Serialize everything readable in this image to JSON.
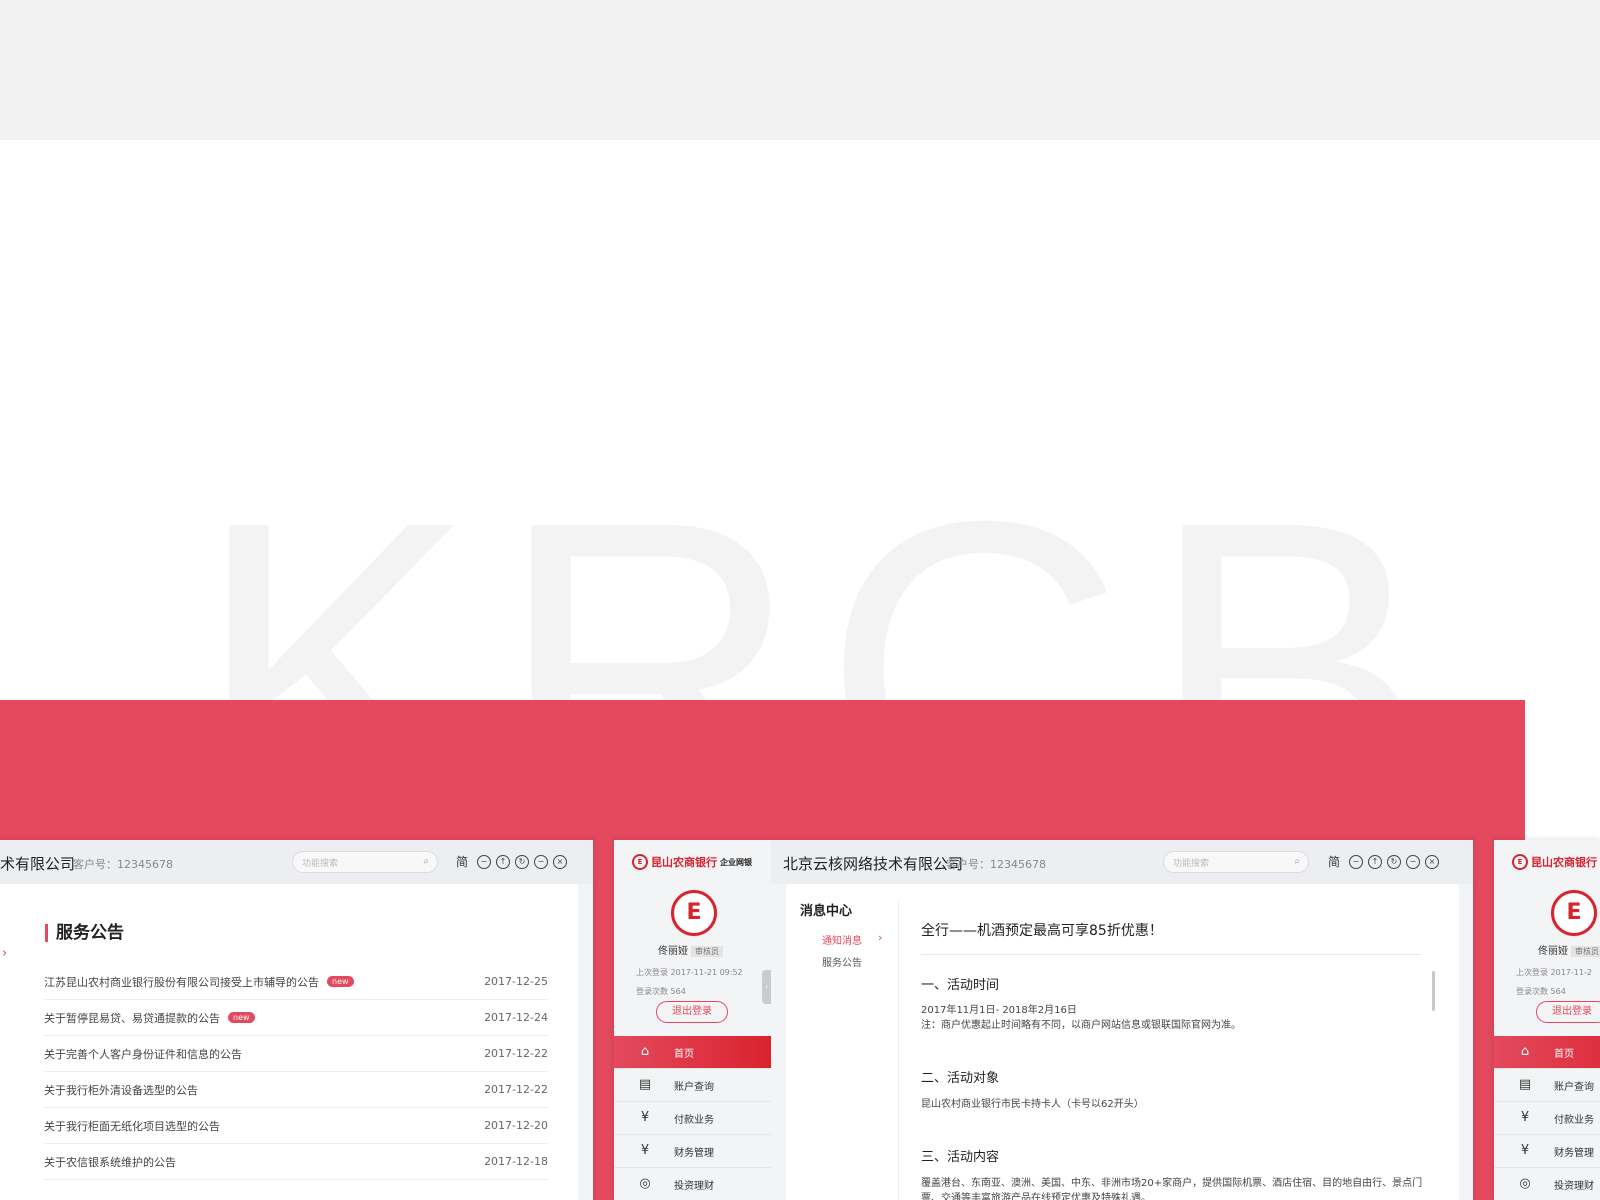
{
  "backdrop": {
    "letters": "KRCB"
  },
  "accent": "#e4495e",
  "company": "北京云核网络技术有限公司",
  "customer_no": "客户号：12345678",
  "search_placeholder": "功能搜索",
  "lang_toggle": "简",
  "window_controls": [
    "minus-circle-icon",
    "upload-circle-icon",
    "refresh-circle-icon",
    "minimize-circle-icon",
    "close-circle-icon"
  ],
  "left_window": {
    "company_visible": "术有限公司",
    "announcements_title": "服务公告",
    "rows": [
      {
        "title": "江苏昆山农村商业银行股份有限公司接受上市辅导的公告",
        "badge": "new",
        "date": "2017-12-25"
      },
      {
        "title": "关于暂停昆易贷、易贷通提款的公告",
        "badge": "new",
        "date": "2017-12-24"
      },
      {
        "title": "关于完善个人客户身份证件和信息的公告",
        "badge": "",
        "date": "2017-12-22"
      },
      {
        "title": "关于我行柜外清设备选型的公告",
        "badge": "",
        "date": "2017-12-22"
      },
      {
        "title": "关于我行柜面无纸化项目选型的公告",
        "badge": "",
        "date": "2017-12-20"
      },
      {
        "title": "关于农信银系统维护的公告",
        "badge": "",
        "date": "2017-12-18"
      }
    ]
  },
  "sidebar": {
    "bank_name": "昆山农商银行",
    "bank_suffix": "企业网银",
    "user_name": "佟丽娅",
    "role": "审核员",
    "last_login": "上次登录  2017-11-21 09:52",
    "login_count": "登录次数  564",
    "logout_label": "退出登录",
    "nav": [
      {
        "icon": "home-icon",
        "label": "首页",
        "active": true
      },
      {
        "icon": "account-query-icon",
        "label": "账户查询",
        "active": false
      },
      {
        "icon": "payment-icon",
        "label": "付款业务",
        "active": false
      },
      {
        "icon": "finance-icon",
        "label": "财务管理",
        "active": false
      },
      {
        "icon": "investment-icon",
        "label": "投资理财",
        "active": false
      }
    ]
  },
  "right_sidebar": {
    "user_name": "佟丽娅",
    "role_visible": "审核员",
    "last_login_visible": "上次登录  2017-11-2",
    "login_count": "登录次数  564",
    "logout_label": "退出登录",
    "nav": [
      "首页",
      "账户查询",
      "付款业务",
      "财务管理",
      "投资理财"
    ]
  },
  "message_center": {
    "title": "消息中心",
    "sub_active": "通知消息",
    "sub_other": "服务公告",
    "article": {
      "title": "全行——机酒预定最高可享85折优惠！",
      "s1_head": "一、活动时间",
      "s1_line1": "2017年11月1日- 2018年2月16日",
      "s1_line2": "注：商户优惠起止时间略有不同，以商户网站信息或银联国际官网为准。",
      "s2_head": "二、活动对象",
      "s2_line1": "昆山农村商业银行市民卡持卡人（卡号以62开头）",
      "s3_head": "三、活动内容",
      "s3_line1": "覆盖港台、东南亚、澳洲、美国、中东、非洲市场20+家商户，提供国际机票、酒店住宿、目的地自由行、景点门",
      "s3_line2": "票、交通等丰富旅游产品在线预定优惠及特殊礼遇。"
    }
  }
}
